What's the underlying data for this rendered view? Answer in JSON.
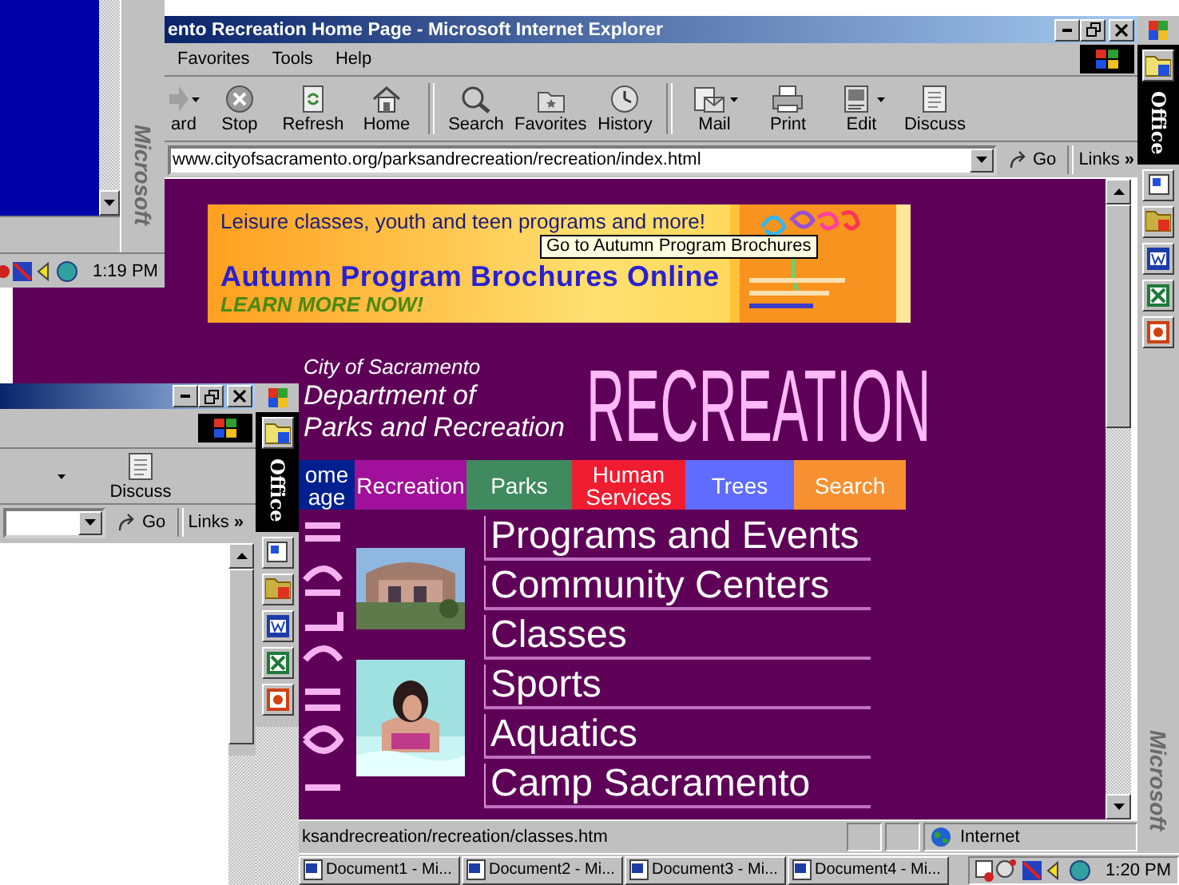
{
  "back_window": {
    "clock": "1:19 PM",
    "brand": "Microsoft"
  },
  "main_window": {
    "title": "ento Recreation Home Page - Microsoft Internet Explorer",
    "menu": [
      "Favorites",
      "Tools",
      "Help"
    ],
    "toolbar_groups": [
      [
        {
          "kind": "forward",
          "label": "ard",
          "dropdown": true
        },
        {
          "kind": "stop",
          "label": "Stop",
          "dropdown": false
        },
        {
          "kind": "refresh",
          "label": "Refresh",
          "dropdown": false
        },
        {
          "kind": "home",
          "label": "Home",
          "dropdown": false
        }
      ],
      [
        {
          "kind": "search",
          "label": "Search",
          "dropdown": false
        },
        {
          "kind": "favorites",
          "label": "Favorites",
          "dropdown": false
        },
        {
          "kind": "history",
          "label": "History",
          "dropdown": false
        }
      ],
      [
        {
          "kind": "mail",
          "label": "Mail",
          "dropdown": true
        },
        {
          "kind": "print",
          "label": "Print",
          "dropdown": false
        },
        {
          "kind": "edit",
          "label": "Edit",
          "dropdown": true
        },
        {
          "kind": "discuss",
          "label": "Discuss",
          "dropdown": false
        }
      ]
    ],
    "address": {
      "url": "www.cityofsacramento.org/parksandrecreation/recreation/index.html"
    },
    "go": "Go",
    "links": "Links",
    "links_chevron": "»",
    "status": {
      "text": "ksandrecreation/recreation/classes.htm",
      "zone": "Internet"
    }
  },
  "page": {
    "banner": {
      "tagline": "Leisure classes, youth and teen programs and more!",
      "headline": "Autumn Program Brochures Online",
      "call_to_action": "LEARN MORE NOW!"
    },
    "tooltip": "Go to Autumn Program Brochures",
    "department": {
      "city": "City of Sacramento",
      "name_lines": [
        "Department of",
        "Parks and Recreation"
      ]
    },
    "section_title": "RECREATION",
    "nav": [
      {
        "label": "ome age",
        "color": "#00208f"
      },
      {
        "label": "Recreation",
        "color": "#a0109a"
      },
      {
        "label": "Parks",
        "color": "#3f8a5f"
      },
      {
        "label": "Human Services",
        "color": "#f01c30"
      },
      {
        "label": "Trees",
        "color": "#5f6cff"
      },
      {
        "label": "Search",
        "color": "#f79030"
      }
    ],
    "links": [
      "Programs and Events",
      "Community Centers",
      "Classes",
      "Sports",
      "Aquatics",
      "Camp Sacramento"
    ]
  },
  "office_bar": {
    "label": "Office",
    "brand": "Microsoft"
  },
  "front_window": {
    "toolbar": [
      {
        "kind": "discuss",
        "label": "Discuss",
        "dropdown": false
      }
    ],
    "go": "Go",
    "links": "Links",
    "links_chevron": "»"
  },
  "front_office_bar": {
    "label": "Office"
  },
  "taskbar": {
    "tasks": [
      "Document1 - Mi...",
      "Document2 - Mi...",
      "Document3 - Mi...",
      "Document4 - Mi..."
    ],
    "clock": "1:20 PM"
  }
}
